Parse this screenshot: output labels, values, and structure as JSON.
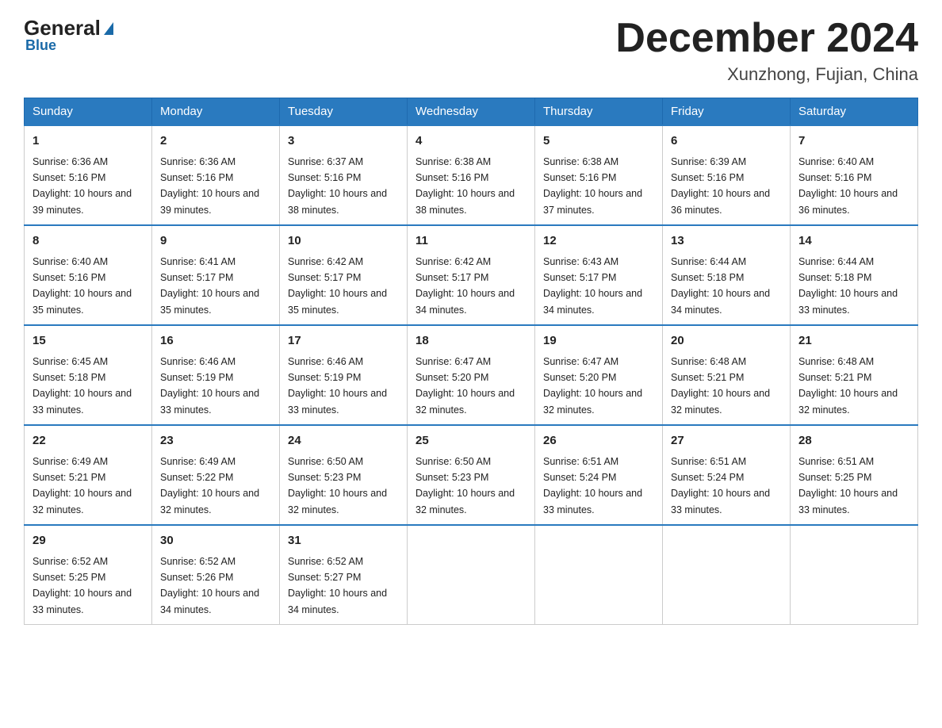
{
  "header": {
    "logo_general": "General",
    "logo_blue": "Blue",
    "month_title": "December 2024",
    "location": "Xunzhong, Fujian, China"
  },
  "days_of_week": [
    "Sunday",
    "Monday",
    "Tuesday",
    "Wednesday",
    "Thursday",
    "Friday",
    "Saturday"
  ],
  "weeks": [
    [
      {
        "day": "1",
        "sunrise": "6:36 AM",
        "sunset": "5:16 PM",
        "daylight": "10 hours and 39 minutes."
      },
      {
        "day": "2",
        "sunrise": "6:36 AM",
        "sunset": "5:16 PM",
        "daylight": "10 hours and 39 minutes."
      },
      {
        "day": "3",
        "sunrise": "6:37 AM",
        "sunset": "5:16 PM",
        "daylight": "10 hours and 38 minutes."
      },
      {
        "day": "4",
        "sunrise": "6:38 AM",
        "sunset": "5:16 PM",
        "daylight": "10 hours and 38 minutes."
      },
      {
        "day": "5",
        "sunrise": "6:38 AM",
        "sunset": "5:16 PM",
        "daylight": "10 hours and 37 minutes."
      },
      {
        "day": "6",
        "sunrise": "6:39 AM",
        "sunset": "5:16 PM",
        "daylight": "10 hours and 36 minutes."
      },
      {
        "day": "7",
        "sunrise": "6:40 AM",
        "sunset": "5:16 PM",
        "daylight": "10 hours and 36 minutes."
      }
    ],
    [
      {
        "day": "8",
        "sunrise": "6:40 AM",
        "sunset": "5:16 PM",
        "daylight": "10 hours and 35 minutes."
      },
      {
        "day": "9",
        "sunrise": "6:41 AM",
        "sunset": "5:17 PM",
        "daylight": "10 hours and 35 minutes."
      },
      {
        "day": "10",
        "sunrise": "6:42 AM",
        "sunset": "5:17 PM",
        "daylight": "10 hours and 35 minutes."
      },
      {
        "day": "11",
        "sunrise": "6:42 AM",
        "sunset": "5:17 PM",
        "daylight": "10 hours and 34 minutes."
      },
      {
        "day": "12",
        "sunrise": "6:43 AM",
        "sunset": "5:17 PM",
        "daylight": "10 hours and 34 minutes."
      },
      {
        "day": "13",
        "sunrise": "6:44 AM",
        "sunset": "5:18 PM",
        "daylight": "10 hours and 34 minutes."
      },
      {
        "day": "14",
        "sunrise": "6:44 AM",
        "sunset": "5:18 PM",
        "daylight": "10 hours and 33 minutes."
      }
    ],
    [
      {
        "day": "15",
        "sunrise": "6:45 AM",
        "sunset": "5:18 PM",
        "daylight": "10 hours and 33 minutes."
      },
      {
        "day": "16",
        "sunrise": "6:46 AM",
        "sunset": "5:19 PM",
        "daylight": "10 hours and 33 minutes."
      },
      {
        "day": "17",
        "sunrise": "6:46 AM",
        "sunset": "5:19 PM",
        "daylight": "10 hours and 33 minutes."
      },
      {
        "day": "18",
        "sunrise": "6:47 AM",
        "sunset": "5:20 PM",
        "daylight": "10 hours and 32 minutes."
      },
      {
        "day": "19",
        "sunrise": "6:47 AM",
        "sunset": "5:20 PM",
        "daylight": "10 hours and 32 minutes."
      },
      {
        "day": "20",
        "sunrise": "6:48 AM",
        "sunset": "5:21 PM",
        "daylight": "10 hours and 32 minutes."
      },
      {
        "day": "21",
        "sunrise": "6:48 AM",
        "sunset": "5:21 PM",
        "daylight": "10 hours and 32 minutes."
      }
    ],
    [
      {
        "day": "22",
        "sunrise": "6:49 AM",
        "sunset": "5:21 PM",
        "daylight": "10 hours and 32 minutes."
      },
      {
        "day": "23",
        "sunrise": "6:49 AM",
        "sunset": "5:22 PM",
        "daylight": "10 hours and 32 minutes."
      },
      {
        "day": "24",
        "sunrise": "6:50 AM",
        "sunset": "5:23 PM",
        "daylight": "10 hours and 32 minutes."
      },
      {
        "day": "25",
        "sunrise": "6:50 AM",
        "sunset": "5:23 PM",
        "daylight": "10 hours and 32 minutes."
      },
      {
        "day": "26",
        "sunrise": "6:51 AM",
        "sunset": "5:24 PM",
        "daylight": "10 hours and 33 minutes."
      },
      {
        "day": "27",
        "sunrise": "6:51 AM",
        "sunset": "5:24 PM",
        "daylight": "10 hours and 33 minutes."
      },
      {
        "day": "28",
        "sunrise": "6:51 AM",
        "sunset": "5:25 PM",
        "daylight": "10 hours and 33 minutes."
      }
    ],
    [
      {
        "day": "29",
        "sunrise": "6:52 AM",
        "sunset": "5:25 PM",
        "daylight": "10 hours and 33 minutes."
      },
      {
        "day": "30",
        "sunrise": "6:52 AM",
        "sunset": "5:26 PM",
        "daylight": "10 hours and 34 minutes."
      },
      {
        "day": "31",
        "sunrise": "6:52 AM",
        "sunset": "5:27 PM",
        "daylight": "10 hours and 34 minutes."
      },
      null,
      null,
      null,
      null
    ]
  ]
}
